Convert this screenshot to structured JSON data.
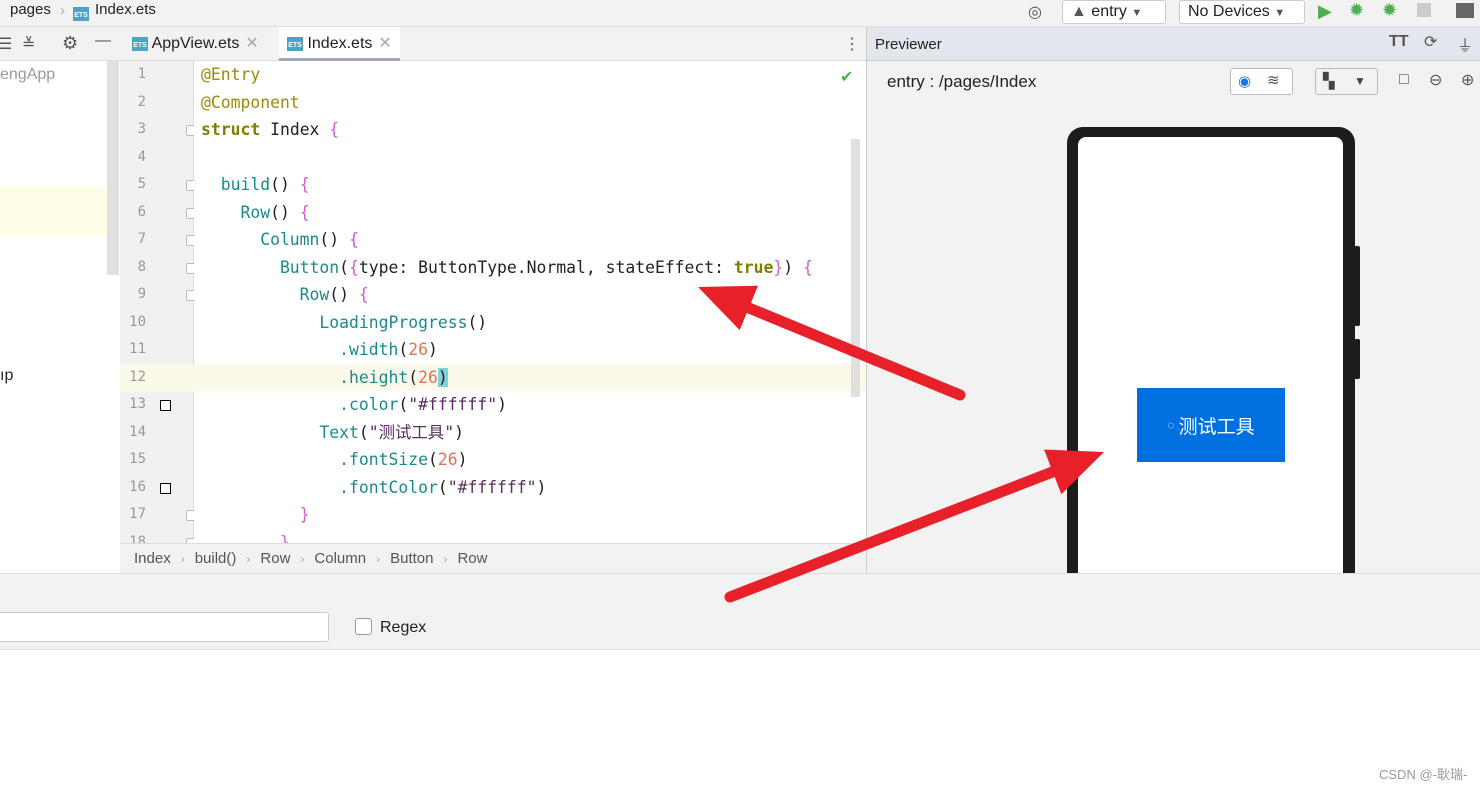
{
  "topbar": {
    "breadcrumb": [
      "pages",
      "Index.ets"
    ],
    "module": "entry",
    "device": "No Devices"
  },
  "left_panel": {
    "project_label": "engApp",
    "item_fragment": "ıp"
  },
  "tabs": [
    {
      "label": "AppView.ets",
      "active": false
    },
    {
      "label": "Index.ets",
      "active": true
    }
  ],
  "file_icon_label": "ETS",
  "code": [
    [
      [
        "@Entry",
        "an"
      ]
    ],
    [
      [
        "@Component",
        "an"
      ]
    ],
    [
      [
        "struct",
        "kw"
      ],
      [
        " Index ",
        "tx"
      ],
      [
        "{",
        "br"
      ]
    ],
    [],
    [
      [
        "  build",
        "cp"
      ],
      [
        "() ",
        "tx"
      ],
      [
        "{",
        "br"
      ]
    ],
    [
      [
        "    Row",
        "cp"
      ],
      [
        "() ",
        "tx"
      ],
      [
        "{",
        "br"
      ]
    ],
    [
      [
        "      Column",
        "cp"
      ],
      [
        "() ",
        "tx"
      ],
      [
        "{",
        "br"
      ]
    ],
    [
      [
        "        Button",
        "cp"
      ],
      [
        "(",
        "tx"
      ],
      [
        "{",
        "br"
      ],
      [
        "type: ButtonType.Normal, stateEffect: ",
        "pr"
      ],
      [
        "true",
        "kw"
      ],
      [
        "}",
        "br"
      ],
      [
        ") ",
        "tx"
      ],
      [
        "{",
        "br"
      ]
    ],
    [
      [
        "          Row",
        "cp"
      ],
      [
        "() ",
        "tx"
      ],
      [
        "{",
        "br"
      ]
    ],
    [
      [
        "            LoadingProgress",
        "cp"
      ],
      [
        "()",
        "tx"
      ]
    ],
    [
      [
        "              .width",
        "cp"
      ],
      [
        "(",
        "tx"
      ],
      [
        "26",
        "nm"
      ],
      [
        ")",
        "tx"
      ]
    ],
    [
      [
        "              .height",
        "cp"
      ],
      [
        "(",
        "tx"
      ],
      [
        "26",
        "nm"
      ],
      [
        ")",
        "hl"
      ]
    ],
    [
      [
        "              .color",
        "cp"
      ],
      [
        "(",
        "tx"
      ],
      [
        "\"#ffffff\"",
        "st"
      ],
      [
        ")",
        "tx"
      ]
    ],
    [
      [
        "            Text",
        "cp"
      ],
      [
        "(",
        "tx"
      ],
      [
        "\"测试工具\"",
        "st"
      ],
      [
        ")",
        "tx"
      ]
    ],
    [
      [
        "              .fontSize",
        "cp"
      ],
      [
        "(",
        "tx"
      ],
      [
        "26",
        "nm"
      ],
      [
        ")",
        "tx"
      ]
    ],
    [
      [
        "              .fontColor",
        "cp"
      ],
      [
        "(",
        "tx"
      ],
      [
        "\"#ffffff\"",
        "st"
      ],
      [
        ")",
        "tx"
      ]
    ],
    [
      [
        "          }",
        "br"
      ]
    ],
    [
      [
        "        }",
        "br"
      ]
    ]
  ],
  "current_line": 12,
  "breadcrumb": [
    "Index",
    "build()",
    "Row",
    "Column",
    "Button",
    "Row"
  ],
  "previewer": {
    "title": "Previewer",
    "path": "entry : /pages/Index",
    "button_text": "测试工具",
    "button_color": "#0070e0"
  },
  "search": {
    "regex_label": "Regex",
    "regex_checked": false,
    "value": ""
  },
  "watermark": "CSDN @-耿瑞-",
  "annotation_color": "#e8202a"
}
